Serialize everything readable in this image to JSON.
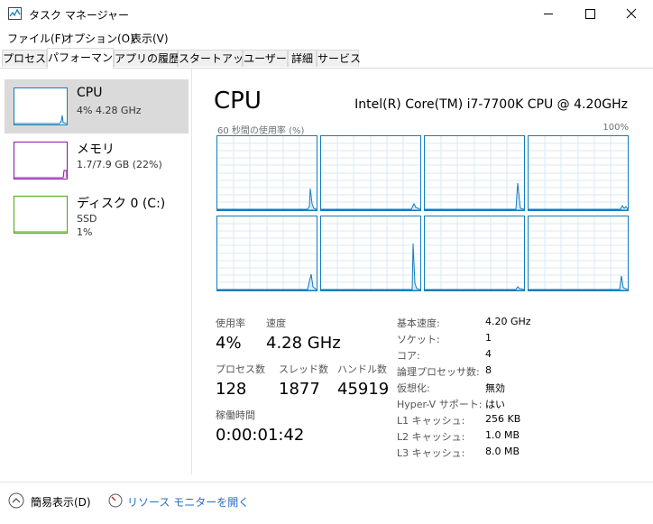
{
  "window": {
    "title": "タスク マネージャー"
  },
  "menu": [
    "ファイル(F)",
    "オプション(O)",
    "表示(V)"
  ],
  "tabs": [
    {
      "label": "プロセス",
      "active": false
    },
    {
      "label": "パフォーマンス",
      "active": true
    },
    {
      "label": "アプリの履歴",
      "active": false
    },
    {
      "label": "スタートアップ",
      "active": false
    },
    {
      "label": "ユーザー",
      "active": false
    },
    {
      "label": "詳細",
      "active": false
    },
    {
      "label": "サービス",
      "active": false
    }
  ],
  "sidebar": {
    "items": [
      {
        "title": "CPU",
        "line1": "4%  4.28 GHz",
        "line2": "",
        "color": "#117dbb"
      },
      {
        "title": "メモリ",
        "line1": "1.7/7.9 GB (22%)",
        "line2": "",
        "color": "#8b12ae"
      },
      {
        "title": "ディスク 0 (C:)",
        "line1": "SSD",
        "line2": "1%",
        "color": "#4da60c"
      }
    ]
  },
  "main": {
    "title": "CPU",
    "model": "Intel(R) Core(TM) i7-7700K CPU @ 4.20GHz",
    "graph_label_left": "60 秒間の使用率 (%)",
    "graph_label_right": "100%",
    "stats": {
      "usage_label": "使用率",
      "usage_value": "4%",
      "speed_label": "速度",
      "speed_value": "4.28 GHz",
      "processes_label": "プロセス数",
      "processes_value": "128",
      "threads_label": "スレッド数",
      "threads_value": "1877",
      "handles_label": "ハンドル数",
      "handles_value": "45919",
      "uptime_label": "稼働時間",
      "uptime_value": "0:00:01:42"
    },
    "details": [
      {
        "key": "基本速度:",
        "value": "4.20 GHz"
      },
      {
        "key": "ソケット:",
        "value": "1"
      },
      {
        "key": "コア:",
        "value": "4"
      },
      {
        "key": "論理プロセッサ数:",
        "value": "8"
      },
      {
        "key": "仮想化:",
        "value": "無効"
      },
      {
        "key": "Hyper-V サポート:",
        "value": "はい"
      },
      {
        "key": "L1 キャッシュ:",
        "value": "256 KB"
      },
      {
        "key": "L2 キャッシュ:",
        "value": "1.0 MB"
      },
      {
        "key": "L3 キャッシュ:",
        "value": "8.0 MB"
      }
    ]
  },
  "footer": {
    "fewer_details": "簡易表示(D)",
    "resource_monitor": "リソース モニターを開く"
  },
  "colors": {
    "cpu": "#117dbb",
    "memory": "#8b12ae",
    "disk": "#4da60c",
    "link": "#1e6fc9"
  }
}
